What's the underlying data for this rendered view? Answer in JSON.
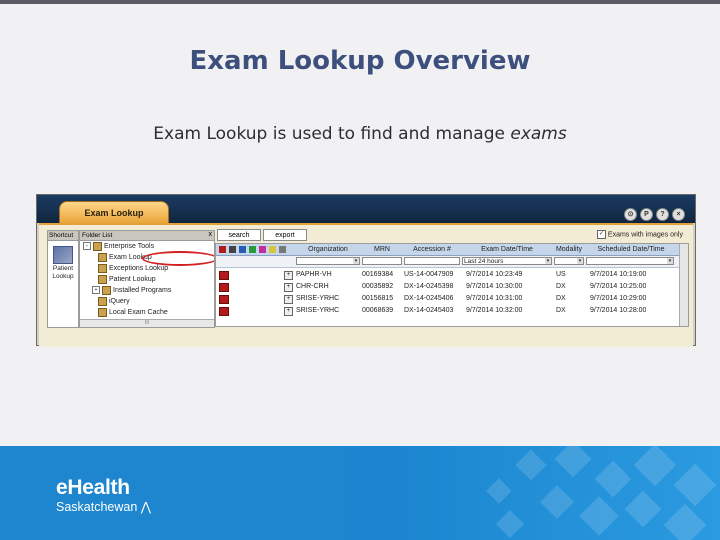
{
  "slide": {
    "title": "Exam Lookup Overview",
    "subtitle_plain": "Exam Lookup is used to find and manage ",
    "subtitle_emph": "exams"
  },
  "window": {
    "tab_label": "Exam Lookup",
    "controls": [
      "⊙",
      "P",
      "?",
      "×"
    ]
  },
  "shortcut": {
    "header": "Shortcut",
    "item_label_1": "Patient",
    "item_label_2": "Lookup"
  },
  "folder": {
    "header": "Folder List",
    "close": "x",
    "items": [
      {
        "label": "Enterprise Tools"
      },
      {
        "label": "Exam Lookup"
      },
      {
        "label": "Exceptions Lookup"
      },
      {
        "label": "Patient Lookup"
      },
      {
        "label": "Installed Programs"
      },
      {
        "label": "iQuery"
      },
      {
        "label": "Local Exam Cache"
      }
    ],
    "scroll_mark": "III"
  },
  "grid": {
    "search_label": "search",
    "export_label": "export",
    "images_only_label": "Exams with images only",
    "images_only_checked": "✓",
    "columns": [
      "Organization",
      "MRN",
      "Accession #",
      "Exam Date/Time",
      "Modality",
      "Scheduled Date/Time"
    ],
    "date_filter": "Last 24 hours",
    "rows": [
      {
        "org": "PAPHR-VH",
        "mrn": "00169384",
        "acc": "US-14-0047909",
        "exam": "9/7/2014 10:23:49",
        "mod": "US",
        "sched": "9/7/2014 10:19:00"
      },
      {
        "org": "CHR-CRH",
        "mrn": "00035892",
        "acc": "DX-14-0245398",
        "exam": "9/7/2014 10:30:00",
        "mod": "DX",
        "sched": "9/7/2014 10:25:00"
      },
      {
        "org": "SRISE-YRHC",
        "mrn": "00156815",
        "acc": "DX-14-0245406",
        "exam": "9/7/2014 10:31:00",
        "mod": "DX",
        "sched": "9/7/2014 10:29:00"
      },
      {
        "org": "SRISE-YRHC",
        "mrn": "00068639",
        "acc": "DX-14-0245403",
        "exam": "9/7/2014 10:32:00",
        "mod": "DX",
        "sched": "9/7/2014 10:28:00"
      }
    ]
  },
  "footer": {
    "logo_main": "eHealth",
    "logo_sub": "Saskatchewan",
    "background_color": "#1e86cf"
  }
}
